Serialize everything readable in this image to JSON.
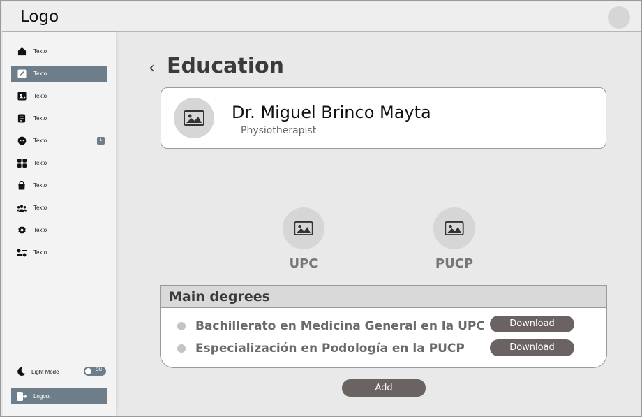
{
  "header": {
    "logo": "Logo"
  },
  "sidebar": {
    "items": [
      {
        "label": "Texto",
        "icon": "home-icon"
      },
      {
        "label": "Texto",
        "icon": "edit-icon"
      },
      {
        "label": "Texto",
        "icon": "image-icon"
      },
      {
        "label": "Texto",
        "icon": "document-icon"
      },
      {
        "label": "Texto",
        "icon": "chat-icon",
        "badge": "1"
      },
      {
        "label": "Texto",
        "icon": "grid-icon"
      },
      {
        "label": "Texto",
        "icon": "bag-icon"
      },
      {
        "label": "Texto",
        "icon": "users-icon"
      },
      {
        "label": "Texto",
        "icon": "gear-icon"
      },
      {
        "label": "Texto",
        "icon": "sliders-icon"
      }
    ],
    "light_mode_label": "Light Mode",
    "toggle_text": "ON",
    "logout_label": "Logout"
  },
  "page": {
    "back_symbol": "‹",
    "title": "Education"
  },
  "profile": {
    "name": "Dr. Miguel Brinco Mayta",
    "role": "Physiotherapist"
  },
  "universities": [
    {
      "label": "UPC"
    },
    {
      "label": "PUCP"
    }
  ],
  "degrees": {
    "title": "Main degrees",
    "items": [
      {
        "text": "Bachillerato en Medicina General en la UPC",
        "button": "Download"
      },
      {
        "text": "Especialización en Podología en la PUCP",
        "button": "Download"
      }
    ]
  },
  "add_label": "Add",
  "colors": {
    "accent": "#6d7d89",
    "button": "#6b6262"
  }
}
